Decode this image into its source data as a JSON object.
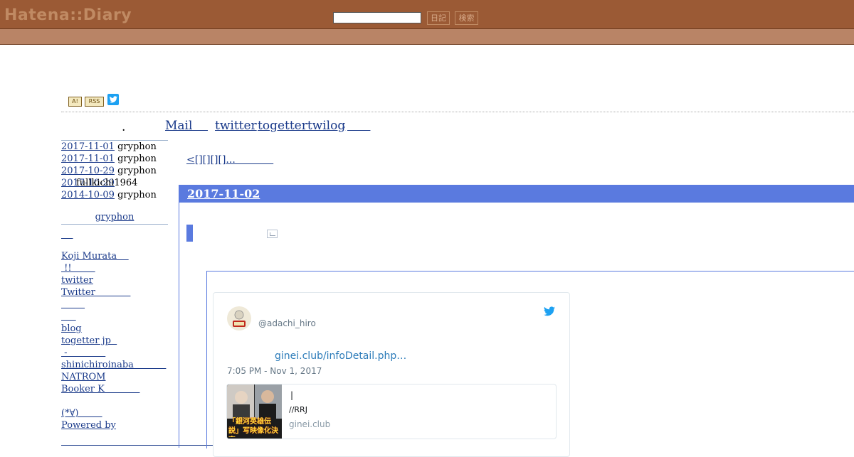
{
  "header": {
    "logo": "Hatena::Diary",
    "search_value": "",
    "diary_button": "日記",
    "search_button": "検索"
  },
  "badges": {
    "a": "A!",
    "rss": "RSS"
  },
  "title_row": {
    "dot": ".",
    "mail": "Mail    ",
    "twitter": "twitter",
    "togetter": "togettertwilog",
    "small": ",",
    "blank": "      "
  },
  "recent_comments": [
    {
      "date": "2017-11-01",
      "user": "gryphon"
    },
    {
      "date": "2017-11-01",
      "user": "gryphon"
    },
    {
      "date": "2017-10-29",
      "user": "gryphon"
    },
    {
      "date": "2017-10-29",
      "user": "fullkichi1964"
    },
    {
      "date": "2014-10-09",
      "user": "gryphon"
    }
  ],
  "sidebar": {
    "title": "gryphon",
    "blank": "    ",
    "links": [
      "Koji Murata    ",
      " !!        ",
      "twitter",
      "Twitter            ",
      "        ",
      "     ",
      "blog",
      "togetter jp  ",
      " -             ",
      "shinichiroinaba           ",
      "NATROM",
      "Booker K            ",
      "",
      "(*∀)        ",
      "Powered by"
    ]
  },
  "main": {
    "prev_link": "<[][][][]...            ",
    "day_title": "2017-11-02"
  },
  "tweet": {
    "handle": "@adachi_hiro",
    "link": "ginei.club/infoDetail.php…",
    "time": "7:05 PM - Nov 1, 2017",
    "card_title": "|",
    "card_desc": "//RRJ",
    "card_domain": "ginei.club",
    "card_image_text": "「銀河英雄伝説」写映像化決定"
  },
  "colors": {
    "header_bg": "#9b5a35",
    "header_bg2": "#b98466",
    "day_header": "#5a7adf",
    "link": "#1a3a8a",
    "twitter_blue": "#1da1f2"
  }
}
